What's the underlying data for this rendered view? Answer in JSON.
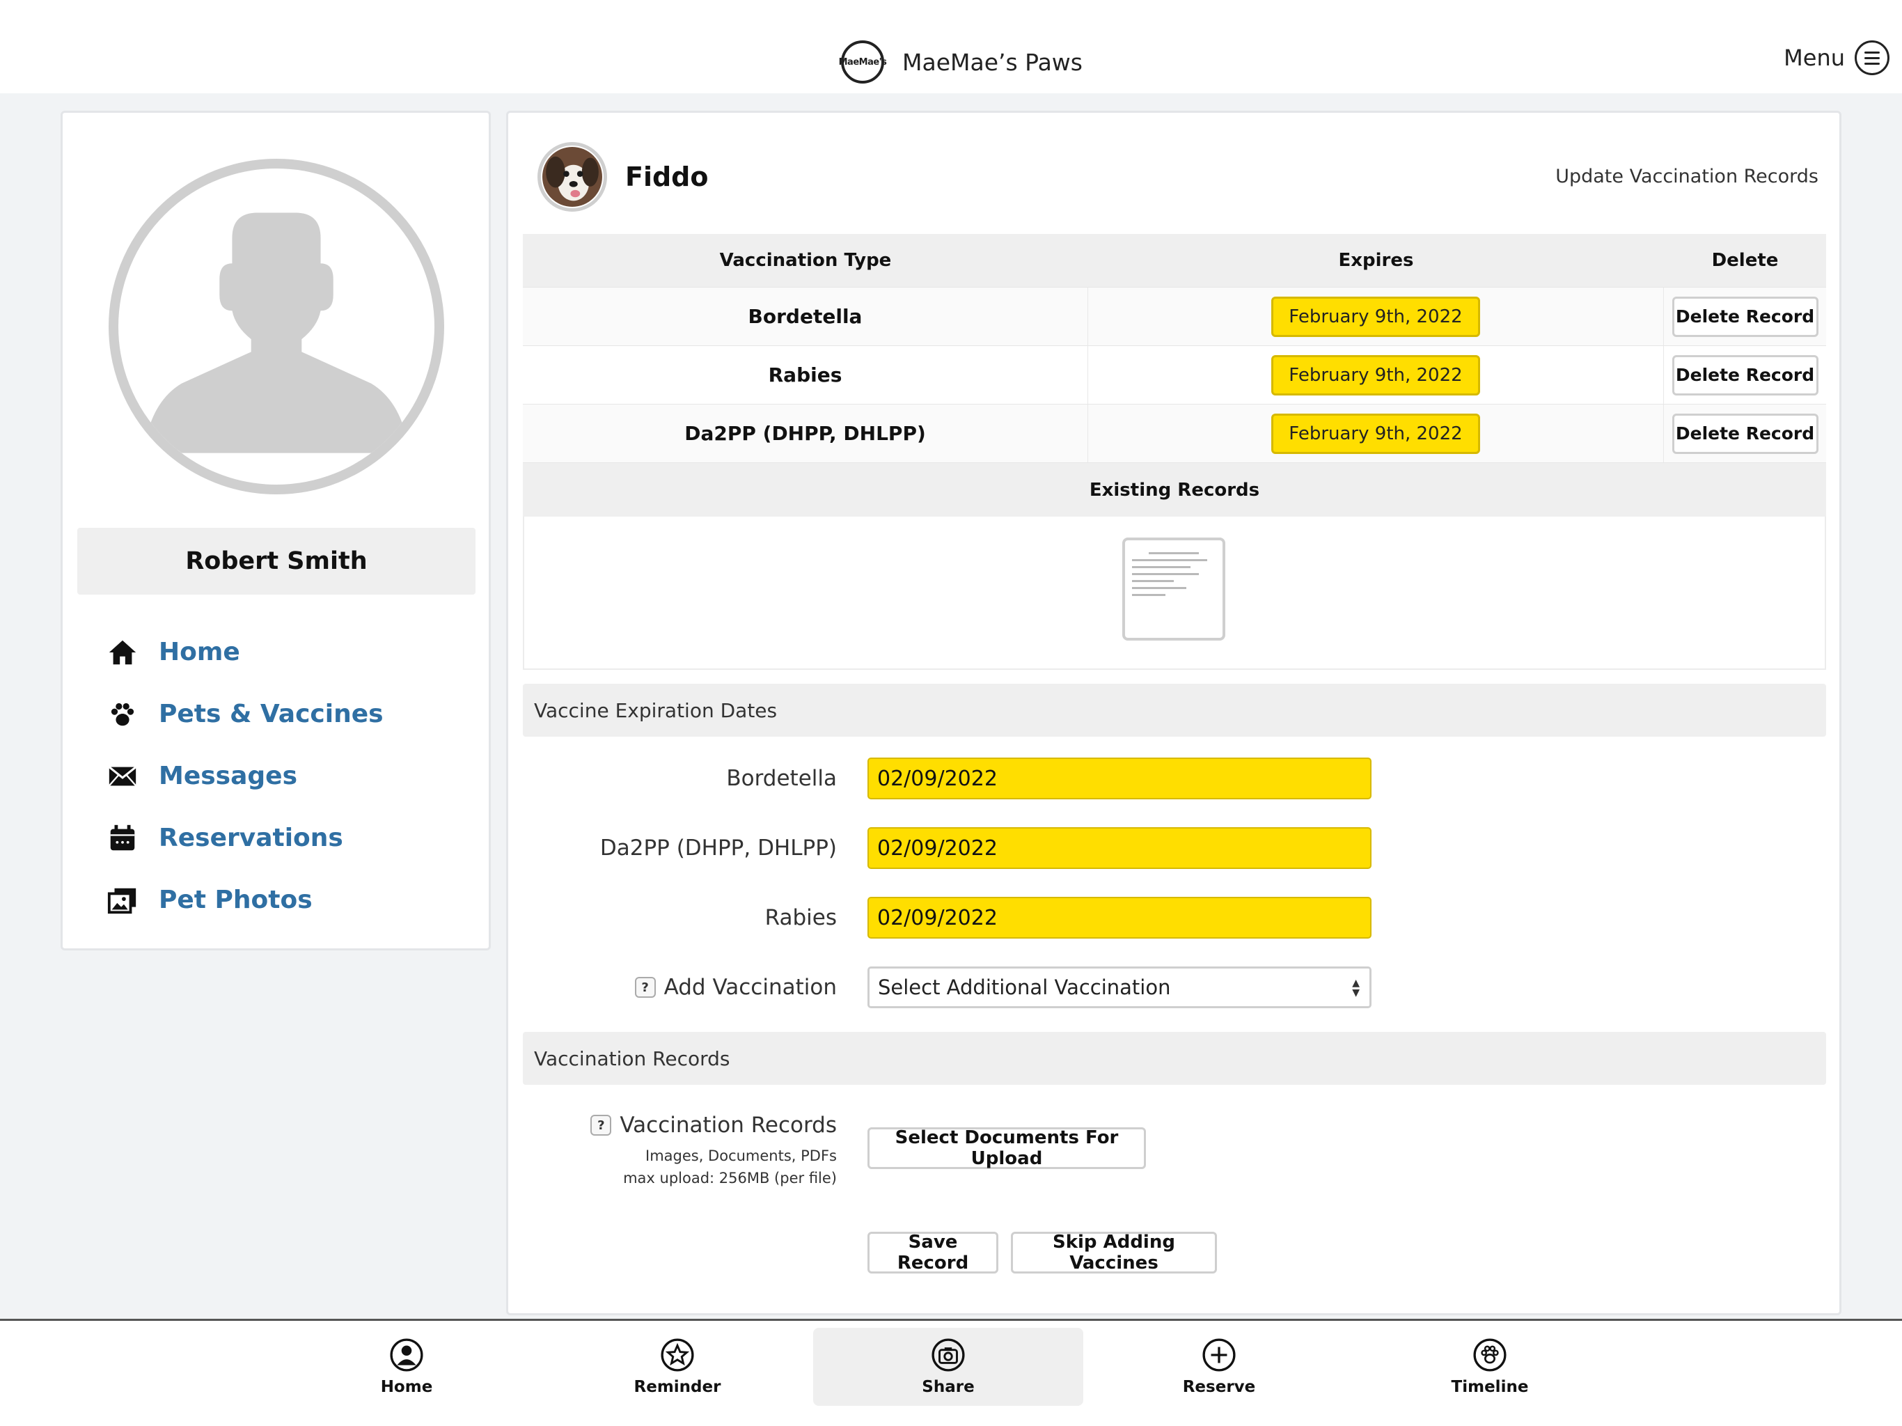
{
  "app": {
    "name": "MaeMae’s Paws",
    "logo_text": "MaeMae's",
    "menu_label": "Menu"
  },
  "owner": {
    "name": "Robert Smith"
  },
  "sidebar": {
    "items": [
      {
        "label": "Home",
        "icon": "home-icon"
      },
      {
        "label": "Pets & Vaccines",
        "icon": "paw-icon"
      },
      {
        "label": "Messages",
        "icon": "envelope-icon"
      },
      {
        "label": "Reservations",
        "icon": "calendar-icon"
      },
      {
        "label": "Pet Photos",
        "icon": "photos-icon"
      }
    ]
  },
  "pet": {
    "name": "Fiddo",
    "update_link": "Update Vaccination Records"
  },
  "table": {
    "headers": {
      "type": "Vaccination Type",
      "expires": "Expires",
      "delete": "Delete"
    },
    "rows": [
      {
        "type": "Bordetella",
        "expires": "February 9th, 2022",
        "action": "Delete Record"
      },
      {
        "type": "Rabies",
        "expires": "February 9th, 2022",
        "action": "Delete Record"
      },
      {
        "type": "Da2PP (DHPP, DHLPP)",
        "expires": "February 9th, 2022",
        "action": "Delete Record"
      }
    ],
    "existing_records_label": "Existing Records"
  },
  "expiration_section": {
    "title": "Vaccine Expiration Dates",
    "fields": [
      {
        "label": "Bordetella",
        "value": "02/09/2022"
      },
      {
        "label": "Da2PP (DHPP, DHLPP)",
        "value": "02/09/2022"
      },
      {
        "label": "Rabies",
        "value": "02/09/2022"
      }
    ],
    "add_vaccination": {
      "label": "Add Vaccination",
      "help": "?",
      "selected": "Select Additional Vaccination"
    }
  },
  "records_section": {
    "title": "Vaccination Records",
    "label": "Vaccination Records",
    "help": "?",
    "hint_types": "Images, Documents, PDFs",
    "hint_size": "max upload: 256MB (per file)",
    "upload_button": "Select Documents For Upload"
  },
  "actions": {
    "save": "Save Record",
    "skip": "Skip Adding Vaccines"
  },
  "tabbar": {
    "tabs": [
      {
        "label": "Home",
        "icon": "person-icon"
      },
      {
        "label": "Reminder",
        "icon": "star-icon"
      },
      {
        "label": "Share",
        "icon": "camera-icon",
        "active": true
      },
      {
        "label": "Reserve",
        "icon": "plus-icon"
      },
      {
        "label": "Timeline",
        "icon": "paw-icon"
      }
    ]
  },
  "colors": {
    "accent_yellow": "#ffde00",
    "link_blue": "#2f6fa3"
  }
}
